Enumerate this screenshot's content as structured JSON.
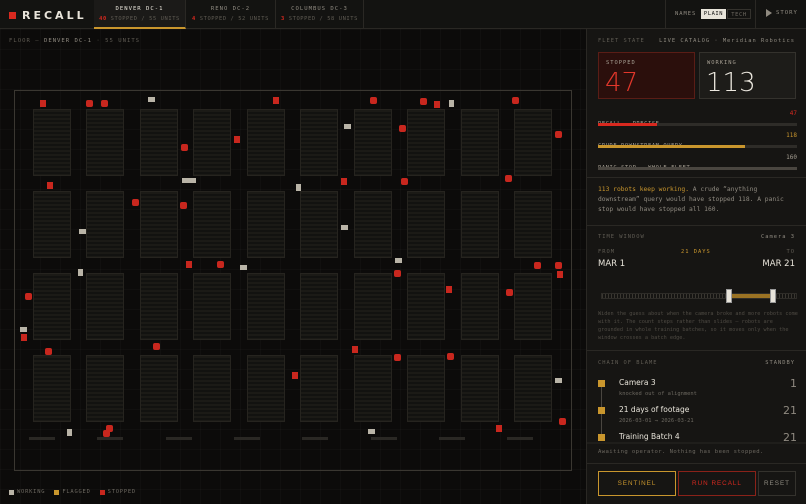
{
  "app": {
    "title": "RECALL"
  },
  "sites": [
    {
      "name": "DENVER DC-1",
      "stopped": "40",
      "status": "STOPPED / 55 UNITS",
      "active": true
    },
    {
      "name": "RENO DC-2",
      "stopped": "4",
      "status": "STOPPED / 52 UNITS",
      "active": false
    },
    {
      "name": "COLUMBUS DC-3",
      "stopped": "3",
      "status": "STOPPED / 58 UNITS",
      "active": false
    }
  ],
  "names": {
    "label": "NAMES",
    "options": [
      "PLAIN",
      "TECH"
    ],
    "selected": "PLAIN"
  },
  "story": {
    "label": "STORY",
    "icon": "play-icon"
  },
  "floor": {
    "caption_prefix": "FLOOR —",
    "site": "DENVER DC-1",
    "units": "· 55 UNITS",
    "legend": [
      {
        "label": "WORKING",
        "color": "#b9b4a7"
      },
      {
        "label": "FLAGGED",
        "color": "#c9962d"
      },
      {
        "label": "STOPPED",
        "color": "#c8271e"
      }
    ]
  },
  "panel": {
    "fleet_state": "FLEET STATE",
    "catalog_prefix": "LIVE CATALOG ·",
    "catalog_name": "Meridian Robotics",
    "stopped_label": "STOPPED",
    "stopped_count": "47",
    "working_label": "WORKING",
    "working_count": "113",
    "bars": [
      {
        "label": "RECALL — PRECISE",
        "value": "47",
        "fraction": 0.294,
        "color": "#d8291f"
      },
      {
        "label": "CRUDE DOWNSTREAM QUERY",
        "value": "118",
        "fraction": 0.7375,
        "color": "#c9962d"
      },
      {
        "label": "PANIC STOP — WHOLE FLEET",
        "value": "160",
        "fraction": 1.0,
        "color": "#4a4640"
      }
    ],
    "summary_highlight": "113 robots keep working.",
    "summary_rest": " A crude “anything downstream” query would have stopped 118. A panic stop would have stopped all 160.",
    "time_window": {
      "label": "TIME WINDOW",
      "camera": "Camera 3",
      "from_label": "FROM",
      "to_label": "TO",
      "days": "21 DAYS",
      "from": "MAR 1",
      "to": "MAR 21",
      "selection_start": 0.655,
      "selection_end": 0.875,
      "note": "Widen the guess about when the camera broke and more robots come with it. The count steps rather than slides — robots are grounded in whole training batches, so it moves only when the window crosses a batch edge."
    },
    "chain": {
      "label": "CHAIN OF BLAME",
      "status": "STANDBY",
      "items": [
        {
          "title": "Camera 3",
          "sub": "knocked out of alignment",
          "num": "1"
        },
        {
          "title": "21 days of footage",
          "sub": "2026-03-01 → 2026-03-21",
          "num": "21"
        },
        {
          "title": "Training Batch 4",
          "sub": "",
          "num": "21"
        }
      ]
    },
    "operator_status": "Awaiting operator. Nothing has been stopped.",
    "buttons": {
      "sentinel": "SENTINEL",
      "recall": "RUN RECALL",
      "reset": "RESET"
    }
  },
  "colors": {
    "accent_amber": "#c9962d",
    "accent_red": "#d8291f",
    "working": "#b9b4a7"
  }
}
